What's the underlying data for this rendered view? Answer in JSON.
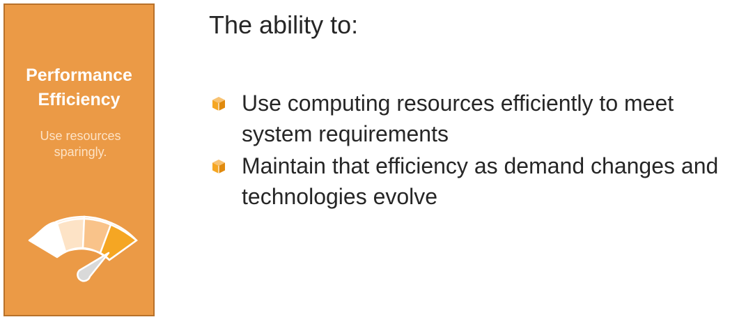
{
  "pillar": {
    "title": "Performance\nEfficiency",
    "subtitle": "Use resources sparingly.",
    "icon": "gauge-icon",
    "colors": {
      "card": "#EB9A46",
      "border": "#B8712A",
      "subtitle": "#FDE3C6"
    }
  },
  "content": {
    "heading": "The ability to:",
    "bullet_icon": "cube-icon",
    "bullet_color": "#F5A623",
    "bullets": [
      {
        "text": "Use computing resources efficiently to meet system requirements"
      },
      {
        "text": "Maintain that efficiency as demand changes and technologies evolve"
      }
    ]
  }
}
